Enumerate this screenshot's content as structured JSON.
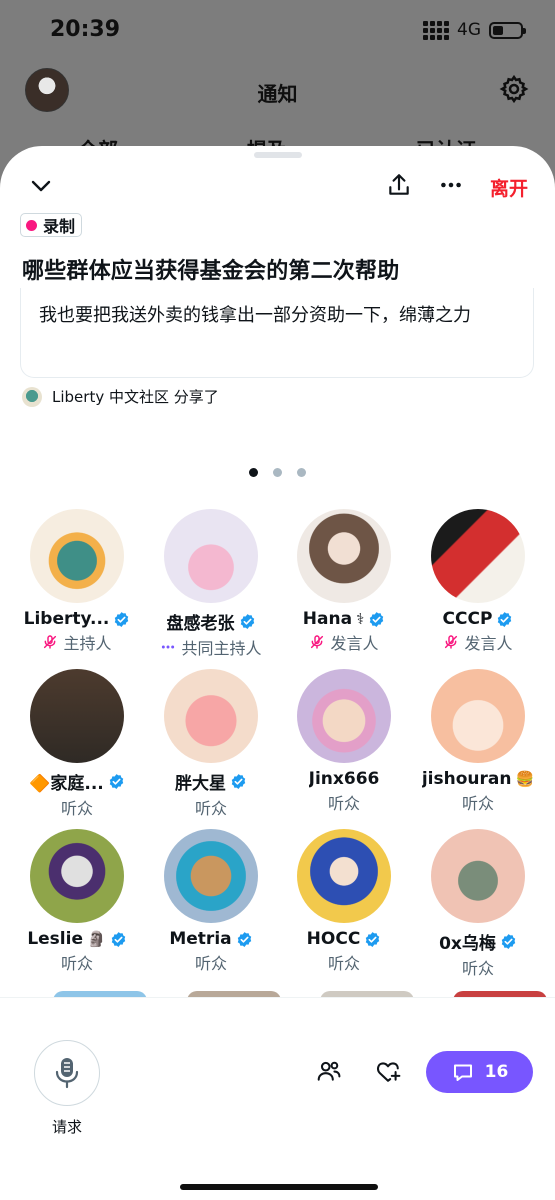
{
  "status_bar": {
    "time": "20:39",
    "network": "4G",
    "battery_level": 0.4
  },
  "background": {
    "title": "通知",
    "tabs": [
      "全部",
      "提及",
      "已认证"
    ]
  },
  "space": {
    "leave_label": "离开",
    "recording_label": "录制",
    "title": "哪些群体应当获得基金会的第二次帮助",
    "comment": "我也要把我送外卖的钱拿出一部分资助一下，绵薄之力",
    "shared_by": "Liberty 中文社区 分享了",
    "page_count": 3,
    "active_page": 0
  },
  "participants": [
    {
      "name": "Liberty...",
      "role": "主持人",
      "role_icon": "muted-mic-icon",
      "verified": true,
      "suffix": ""
    },
    {
      "name": "盘感老张",
      "role": "共同主持人",
      "role_icon": "more-dots-icon",
      "verified": true,
      "suffix": ""
    },
    {
      "name": "Hana ",
      "role": "发言人",
      "role_icon": "muted-mic-icon",
      "verified": true,
      "suffix": "⚕"
    },
    {
      "name": "CCCP",
      "role": "发言人",
      "role_icon": "muted-mic-icon",
      "verified": true,
      "suffix": ""
    },
    {
      "name": "🔶家庭...",
      "role": "听众",
      "role_icon": "",
      "verified": true,
      "suffix": ""
    },
    {
      "name": "胖大星",
      "role": "听众",
      "role_icon": "",
      "verified": true,
      "suffix": ""
    },
    {
      "name": "Jinx666",
      "role": "听众",
      "role_icon": "",
      "verified": false,
      "suffix": ""
    },
    {
      "name": "jishouran",
      "role": "听众",
      "role_icon": "",
      "verified": false,
      "suffix": "🍔"
    },
    {
      "name": "Leslie ",
      "role": "听众",
      "role_icon": "",
      "verified": true,
      "suffix": "🗿"
    },
    {
      "name": "Metria",
      "role": "听众",
      "role_icon": "",
      "verified": true,
      "suffix": ""
    },
    {
      "name": "HOCC",
      "role": "听众",
      "role_icon": "",
      "verified": true,
      "suffix": ""
    },
    {
      "name": "0x乌梅",
      "role": "听众",
      "role_icon": "",
      "verified": true,
      "suffix": ""
    }
  ],
  "bottom_bar": {
    "request_label": "请求",
    "comment_count": "16"
  },
  "colors": {
    "accent_purple": "#7856ff",
    "leave_red": "#f4212e",
    "record_pink": "#f91880",
    "verified_blue": "#1d9bf0",
    "host_pink": "#f91880"
  }
}
